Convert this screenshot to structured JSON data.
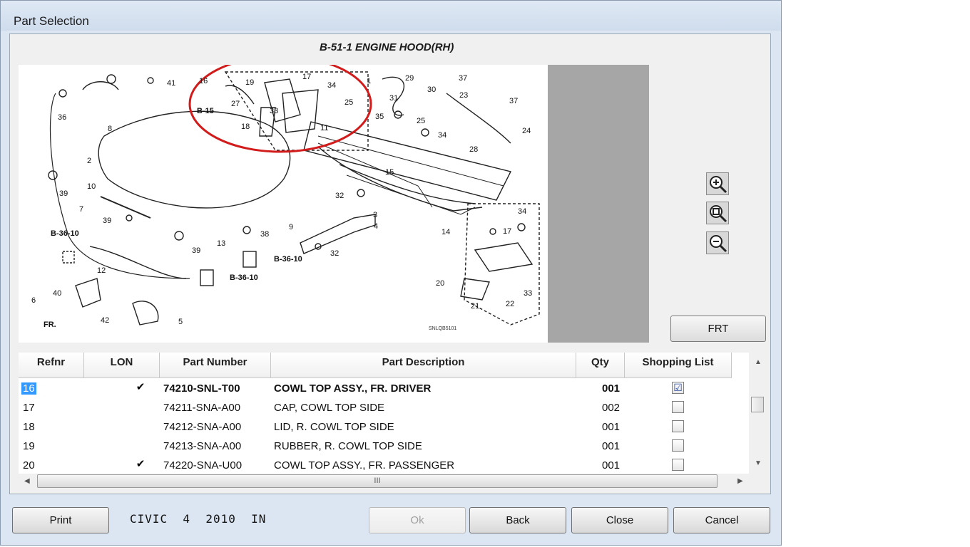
{
  "window": {
    "title": "Part Selection"
  },
  "diagram": {
    "title": "B-51-1 ENGINE HOOD(RH)",
    "code": "SNLQB5101",
    "callouts": [
      "16",
      "19",
      "17",
      "34",
      "27",
      "B-15",
      "33",
      "18",
      "1",
      "29",
      "37",
      "30",
      "23",
      "25",
      "31",
      "35",
      "25",
      "34",
      "37",
      "24",
      "11",
      "28",
      "41",
      "36",
      "8",
      "2",
      "15",
      "10",
      "39",
      "32",
      "7",
      "3",
      "4",
      "39",
      "38",
      "9",
      "B-36-10",
      "13",
      "39",
      "32",
      "12",
      "B-36-10",
      "B-36-10",
      "6",
      "40",
      "42",
      "5",
      "14",
      "34",
      "17",
      "20",
      "21",
      "22",
      "33",
      "FR."
    ]
  },
  "zoom": {
    "in_icon": "zoom-in-icon",
    "fit_icon": "zoom-fit-icon",
    "out_icon": "zoom-out-icon"
  },
  "frt_label": "FRT",
  "table": {
    "headers": [
      "Refnr",
      "LON",
      "Part Number",
      "Part Description",
      "Qty",
      "Shopping List"
    ],
    "rows": [
      {
        "refnr": "16",
        "lon": "✔",
        "part_number": "74210-SNL-T00",
        "description": "COWL TOP ASSY., FR. DRIVER",
        "qty": "001",
        "checked": "☑"
      },
      {
        "refnr": "17",
        "lon": "",
        "part_number": "74211-SNA-A00",
        "description": "CAP, COWL TOP SIDE",
        "qty": "002",
        "checked": ""
      },
      {
        "refnr": "18",
        "lon": "",
        "part_number": "74212-SNA-A00",
        "description": "LID, R. COWL TOP SIDE",
        "qty": "001",
        "checked": ""
      },
      {
        "refnr": "19",
        "lon": "",
        "part_number": "74213-SNA-A00",
        "description": "RUBBER, R. COWL TOP SIDE",
        "qty": "001",
        "checked": ""
      },
      {
        "refnr": "20",
        "lon": "✔",
        "part_number": "74220-SNA-U00",
        "description": "COWL TOP ASSY., FR. PASSENGER",
        "qty": "001",
        "checked": ""
      }
    ],
    "hscroll_grip": "III"
  },
  "footer": {
    "print_label": "Print",
    "vehicle": "CIVIC  4  2010  IN",
    "ok_label": "Ok",
    "back_label": "Back",
    "close_label": "Close",
    "cancel_label": "Cancel"
  }
}
